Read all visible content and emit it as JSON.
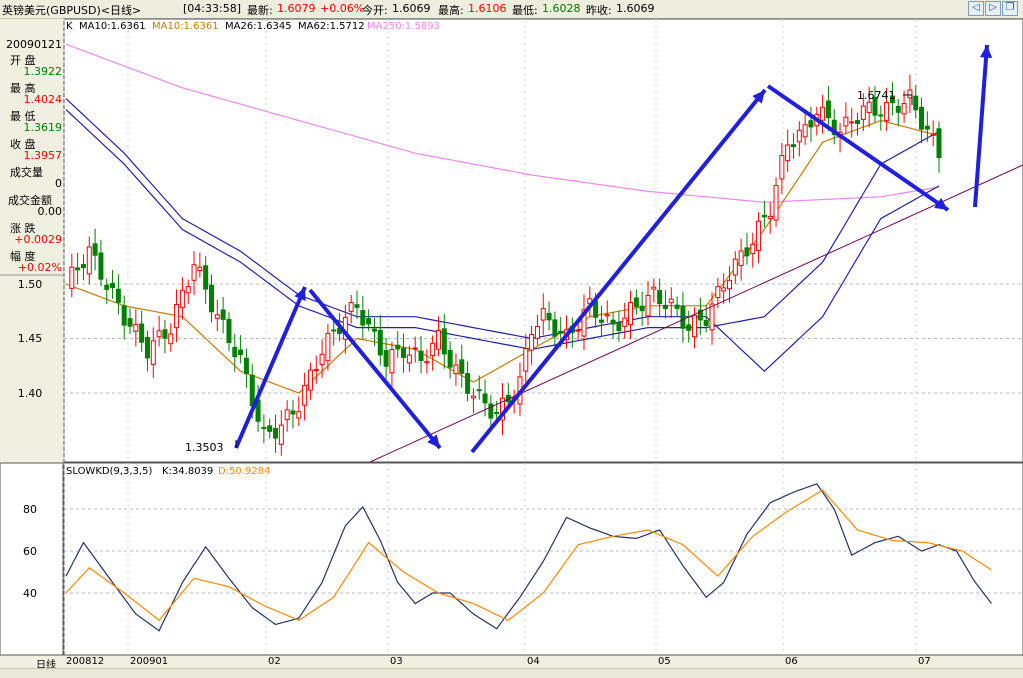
{
  "header": {
    "name": "英镑美元(GBPUSD)<日线>",
    "time": "[04:33:58]",
    "latest_label": "最新:",
    "latest": "1.6079",
    "change": "+0.06%",
    "open_label": "今开:",
    "open": "1.6069",
    "high_label": "最高:",
    "high": "1.6106",
    "low_label": "最低:",
    "low": "1.6028",
    "prev_label": "昨收:",
    "prev": "1.6069"
  },
  "ma_legend": {
    "k": "K",
    "ma10a": "MA10:1.6361",
    "ma10b": "MA10:1.6361",
    "ma26": "MA26:1.6345",
    "ma62": "MA62:1.5712",
    "ma250": "MA250:1.5893"
  },
  "info_panel": {
    "date": "20090121",
    "open_label": "开  盘",
    "open": "1.3922",
    "high_label": "最  高",
    "high": "1.4024",
    "low_label": "最  低",
    "low": "1.3619",
    "close_label": "收  盘",
    "close": "1.3957",
    "volume_label": "成交量",
    "volume": "0",
    "amount_label": "成交金额",
    "amount": "0.00",
    "change_label": "涨  跌",
    "change": "+0.0029",
    "pct_label": "幅  度",
    "pct": "+0.02%"
  },
  "kd_legend": {
    "name": "SLOWKD(9,3,3,5)",
    "k": "K:34.8039",
    "d": "D:50.9284"
  },
  "x_axis": {
    "period_label": "日线",
    "ticks": [
      "200812",
      "200901",
      "02",
      "03",
      "04",
      "05",
      "06",
      "07"
    ]
  },
  "colors": {
    "up": "#ff0000",
    "down": "#008000",
    "ma10": "#cc7a00",
    "ma26": "#2222aa",
    "ma62": "#2222aa",
    "ma250": "#ee88ee",
    "k_line": "#223366",
    "d_line": "#ff8800",
    "arrows": "#1f1fdd",
    "trendline": "#770055"
  },
  "icons": [
    "back-icon",
    "forward-icon",
    "restore-icon"
  ],
  "chart_data": [
    {
      "type": "line",
      "title": "",
      "y_ticks": [
        "1.50",
        "1.45",
        "1.40"
      ],
      "ylim": [
        1.33,
        1.72
      ],
      "x_categories": [
        "200812",
        "200901",
        "02",
        "03",
        "04",
        "05",
        "06",
        "07"
      ],
      "annotations": [
        {
          "text": "1.3503",
          "value": 1.3503
        },
        {
          "text": "1.6741",
          "value": 1.6741
        }
      ],
      "close_series": [
        [
          0,
          1.5
        ],
        [
          4,
          1.53
        ],
        [
          10,
          1.47
        ],
        [
          14,
          1.44
        ],
        [
          18,
          1.46
        ],
        [
          22,
          1.52
        ],
        [
          26,
          1.47
        ],
        [
          30,
          1.43
        ],
        [
          34,
          1.36
        ],
        [
          37,
          1.37
        ],
        [
          40,
          1.39
        ],
        [
          44,
          1.44
        ],
        [
          48,
          1.47
        ],
        [
          50,
          1.48
        ],
        [
          52,
          1.46
        ],
        [
          55,
          1.43
        ],
        [
          58,
          1.44
        ],
        [
          61,
          1.43
        ],
        [
          64,
          1.45
        ],
        [
          67,
          1.42
        ],
        [
          70,
          1.4
        ],
        [
          74,
          1.38
        ],
        [
          78,
          1.41
        ],
        [
          80,
          1.46
        ],
        [
          82,
          1.47
        ],
        [
          86,
          1.45
        ],
        [
          90,
          1.48
        ],
        [
          94,
          1.46
        ],
        [
          98,
          1.48
        ],
        [
          101,
          1.49
        ],
        [
          104,
          1.48
        ],
        [
          107,
          1.46
        ],
        [
          110,
          1.47
        ],
        [
          114,
          1.51
        ],
        [
          118,
          1.54
        ],
        [
          121,
          1.57
        ],
        [
          124,
          1.63
        ],
        [
          127,
          1.64
        ],
        [
          129,
          1.66
        ],
        [
          133,
          1.64
        ],
        [
          137,
          1.66
        ],
        [
          141,
          1.66
        ],
        [
          145,
          1.67
        ],
        [
          148,
          1.64
        ],
        [
          150,
          1.62
        ]
      ],
      "ma26_series": [
        [
          0,
          1.66
        ],
        [
          10,
          1.61
        ],
        [
          20,
          1.55
        ],
        [
          30,
          1.52
        ],
        [
          40,
          1.48
        ],
        [
          50,
          1.46
        ],
        [
          60,
          1.46
        ],
        [
          70,
          1.45
        ],
        [
          80,
          1.44
        ],
        [
          90,
          1.45
        ],
        [
          100,
          1.46
        ],
        [
          110,
          1.46
        ],
        [
          120,
          1.47
        ],
        [
          130,
          1.52
        ],
        [
          140,
          1.61
        ],
        [
          150,
          1.64
        ]
      ],
      "ma250_series": [
        [
          0,
          1.72
        ],
        [
          20,
          1.68
        ],
        [
          40,
          1.65
        ],
        [
          60,
          1.62
        ],
        [
          80,
          1.6
        ],
        [
          100,
          1.585
        ],
        [
          120,
          1.575
        ],
        [
          140,
          1.58
        ],
        [
          150,
          1.589
        ]
      ],
      "ma10_series": [
        [
          0,
          1.5
        ],
        [
          10,
          1.48
        ],
        [
          20,
          1.47
        ],
        [
          30,
          1.42
        ],
        [
          40,
          1.4
        ],
        [
          50,
          1.45
        ],
        [
          60,
          1.44
        ],
        [
          70,
          1.41
        ],
        [
          80,
          1.44
        ],
        [
          90,
          1.47
        ],
        [
          100,
          1.48
        ],
        [
          110,
          1.48
        ],
        [
          120,
          1.55
        ],
        [
          130,
          1.63
        ],
        [
          140,
          1.65
        ],
        [
          150,
          1.636
        ]
      ]
    },
    {
      "type": "line",
      "title": "SLOWKD(9,3,3,5)",
      "y_ticks": [
        "80",
        "60",
        "40"
      ],
      "ylim": [
        20,
        100
      ],
      "series": [
        {
          "name": "K",
          "values": [
            [
              0,
              48
            ],
            [
              3,
              64
            ],
            [
              8,
              45
            ],
            [
              12,
              30
            ],
            [
              16,
              22
            ],
            [
              20,
              45
            ],
            [
              24,
              62
            ],
            [
              28,
              47
            ],
            [
              32,
              33
            ],
            [
              36,
              25
            ],
            [
              40,
              28
            ],
            [
              44,
              45
            ],
            [
              48,
              72
            ],
            [
              51,
              81
            ],
            [
              54,
              65
            ],
            [
              57,
              45
            ],
            [
              60,
              35
            ],
            [
              63,
              40
            ],
            [
              66,
              40
            ],
            [
              70,
              30
            ],
            [
              74,
              23
            ],
            [
              78,
              38
            ],
            [
              82,
              55
            ],
            [
              86,
              76
            ],
            [
              90,
              71
            ],
            [
              94,
              67
            ],
            [
              98,
              66
            ],
            [
              102,
              70
            ],
            [
              106,
              53
            ],
            [
              110,
              38
            ],
            [
              113,
              45
            ],
            [
              117,
              68
            ],
            [
              121,
              83
            ],
            [
              125,
              88
            ],
            [
              129,
              92
            ],
            [
              132,
              80
            ],
            [
              135,
              58
            ],
            [
              139,
              64
            ],
            [
              143,
              67
            ],
            [
              147,
              60
            ],
            [
              150,
              63
            ],
            [
              153,
              60
            ],
            [
              156,
              46
            ],
            [
              159,
              35
            ]
          ]
        },
        {
          "name": "D",
          "values": [
            [
              0,
              40
            ],
            [
              4,
              52
            ],
            [
              10,
              40
            ],
            [
              16,
              27
            ],
            [
              22,
              47
            ],
            [
              28,
              43
            ],
            [
              34,
              34
            ],
            [
              40,
              27
            ],
            [
              46,
              38
            ],
            [
              52,
              64
            ],
            [
              58,
              50
            ],
            [
              64,
              40
            ],
            [
              70,
              35
            ],
            [
              76,
              27
            ],
            [
              82,
              40
            ],
            [
              88,
              63
            ],
            [
              94,
              67
            ],
            [
              100,
              70
            ],
            [
              106,
              63
            ],
            [
              112,
              48
            ],
            [
              118,
              67
            ],
            [
              124,
              79
            ],
            [
              130,
              89
            ],
            [
              136,
              70
            ],
            [
              142,
              65
            ],
            [
              148,
              64
            ],
            [
              154,
              60
            ],
            [
              159,
              51
            ]
          ]
        }
      ]
    }
  ]
}
